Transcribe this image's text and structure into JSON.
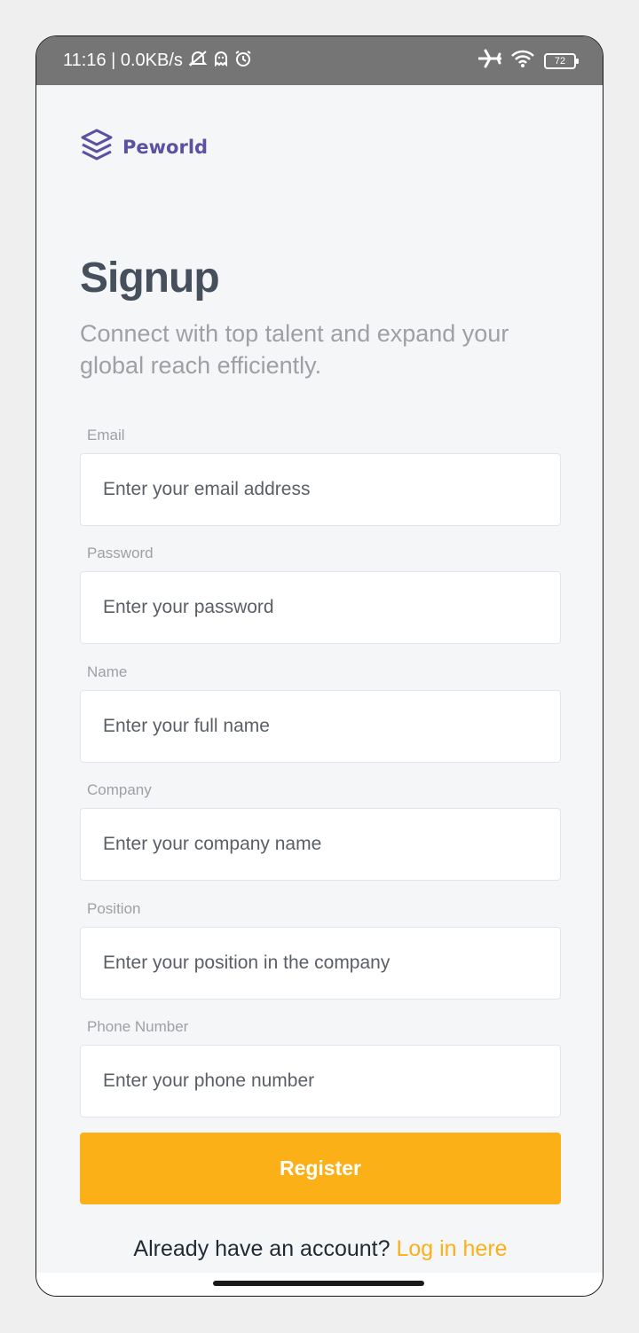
{
  "status_bar": {
    "time_speed": "11:16 | 0.0KB/s",
    "battery": "72",
    "icons": [
      "mute-icon",
      "ghost-icon",
      "alarm-icon",
      "airplane-icon",
      "wifi-icon",
      "battery-icon"
    ]
  },
  "brand": {
    "logo_icon": "layers-icon",
    "name": "Peworld",
    "color": "#5e50a1"
  },
  "page": {
    "title": "Signup",
    "subtitle": "Connect with top talent and expand your global reach efficiently."
  },
  "form": {
    "fields": [
      {
        "label": "Email",
        "placeholder": "Enter your email address"
      },
      {
        "label": "Password",
        "placeholder": "Enter your password"
      },
      {
        "label": "Name",
        "placeholder": "Enter your full name"
      },
      {
        "label": "Company",
        "placeholder": "Enter your company name"
      },
      {
        "label": "Position",
        "placeholder": "Enter your position in the company"
      },
      {
        "label": "Phone Number",
        "placeholder": "Enter your phone number"
      }
    ],
    "register_label": "Register",
    "accent_color": "#fbb017"
  },
  "footer": {
    "prompt": "Already have an account?",
    "link": "Log in here"
  }
}
